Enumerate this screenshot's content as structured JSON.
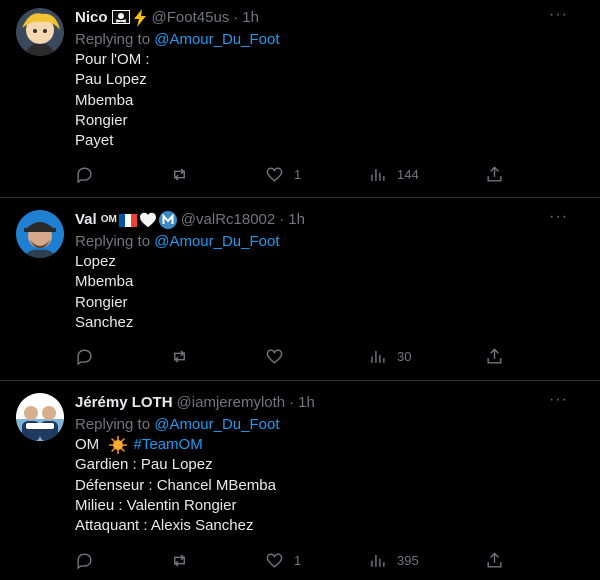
{
  "tweets": [
    {
      "name": "Nico",
      "name_badge": "",
      "emojis": [
        "pirate-flag",
        "lightning"
      ],
      "handle": "@Foot45us",
      "dot": "·",
      "time": "1h",
      "replying_prefix": "Replying to ",
      "replying_to": "@Amour_Du_Foot",
      "lines": [
        "Pour l'OM :",
        "Pau Lopez",
        "Mbemba",
        "Rongier",
        "Payet"
      ],
      "likes": "1",
      "views": "144"
    },
    {
      "name": "Val",
      "name_badge": "OM",
      "emojis": [
        "france-flag",
        "white-heart",
        "m-circle"
      ],
      "handle": "@valRc18002",
      "dot": "·",
      "time": "1h",
      "replying_prefix": "Replying to ",
      "replying_to": "@Amour_Du_Foot",
      "lines": [
        "Lopez",
        "Mbemba",
        "Rongier",
        "Sanchez"
      ],
      "likes": "",
      "views": "30"
    },
    {
      "name": "Jérémy LOTH",
      "name_badge": "",
      "emojis": [],
      "handle": "@iamjeremyloth",
      "dot": "·",
      "time": "1h",
      "replying_prefix": "Replying to ",
      "replying_to": "@Amour_Du_Foot",
      "first_line": {
        "text": "OM",
        "emoji": "sun",
        "hashtag": "#TeamOM"
      },
      "lines": [
        "Gardien : Pau Lopez",
        "Défenseur : Chancel MBemba",
        "Milieu : Valentin Rongier",
        "Attaquant : Alexis Sanchez"
      ],
      "likes": "1",
      "views": "395"
    }
  ],
  "more_glyph": "···",
  "colors": {
    "background": "#000000",
    "text": "#e7e9ea",
    "muted": "#71767b",
    "link": "#1d9bf0",
    "divider": "#2f3336"
  },
  "icons": [
    "reply-icon",
    "retweet-icon",
    "like-icon",
    "views-icon",
    "share-icon",
    "more-icon"
  ]
}
